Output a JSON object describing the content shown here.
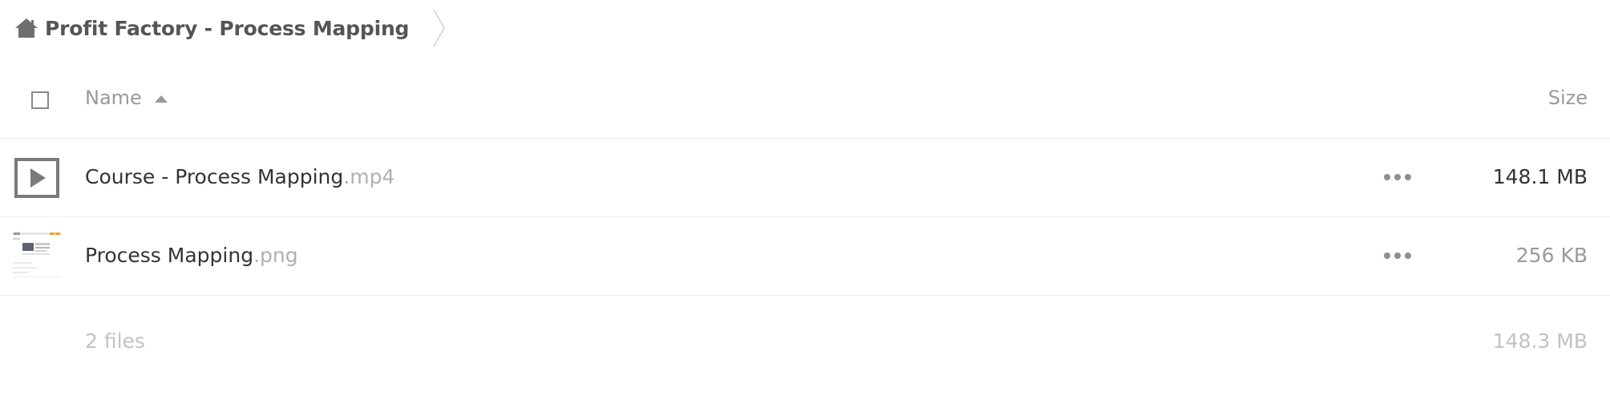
{
  "breadcrumb": {
    "home_icon": "home-icon",
    "folder_name": "Profit Factory - Process Mapping",
    "separator_icon": "chevron-right-icon"
  },
  "table": {
    "header": {
      "name_label": "Name",
      "sort_icon": "sort-ascending-icon",
      "size_label": "Size"
    },
    "files": [
      {
        "base_name": "Course - Process Mapping",
        "extension": ".mp4",
        "size": "148.1 MB",
        "thumbnail": "video-play-icon",
        "actions_icon": "more-horizontal-icon"
      },
      {
        "base_name": "Process Mapping",
        "extension": ".png",
        "size": "256 KB",
        "thumbnail": "image-preview",
        "actions_icon": "more-horizontal-icon"
      }
    ],
    "summary": {
      "count_label": "2 files",
      "total_size": "148.3 MB"
    }
  },
  "colors": {
    "icon_gray": "#7a7a7a",
    "muted_text": "#9a9a9a",
    "faint_text": "#c2c2c2",
    "divider": "#ededed"
  }
}
